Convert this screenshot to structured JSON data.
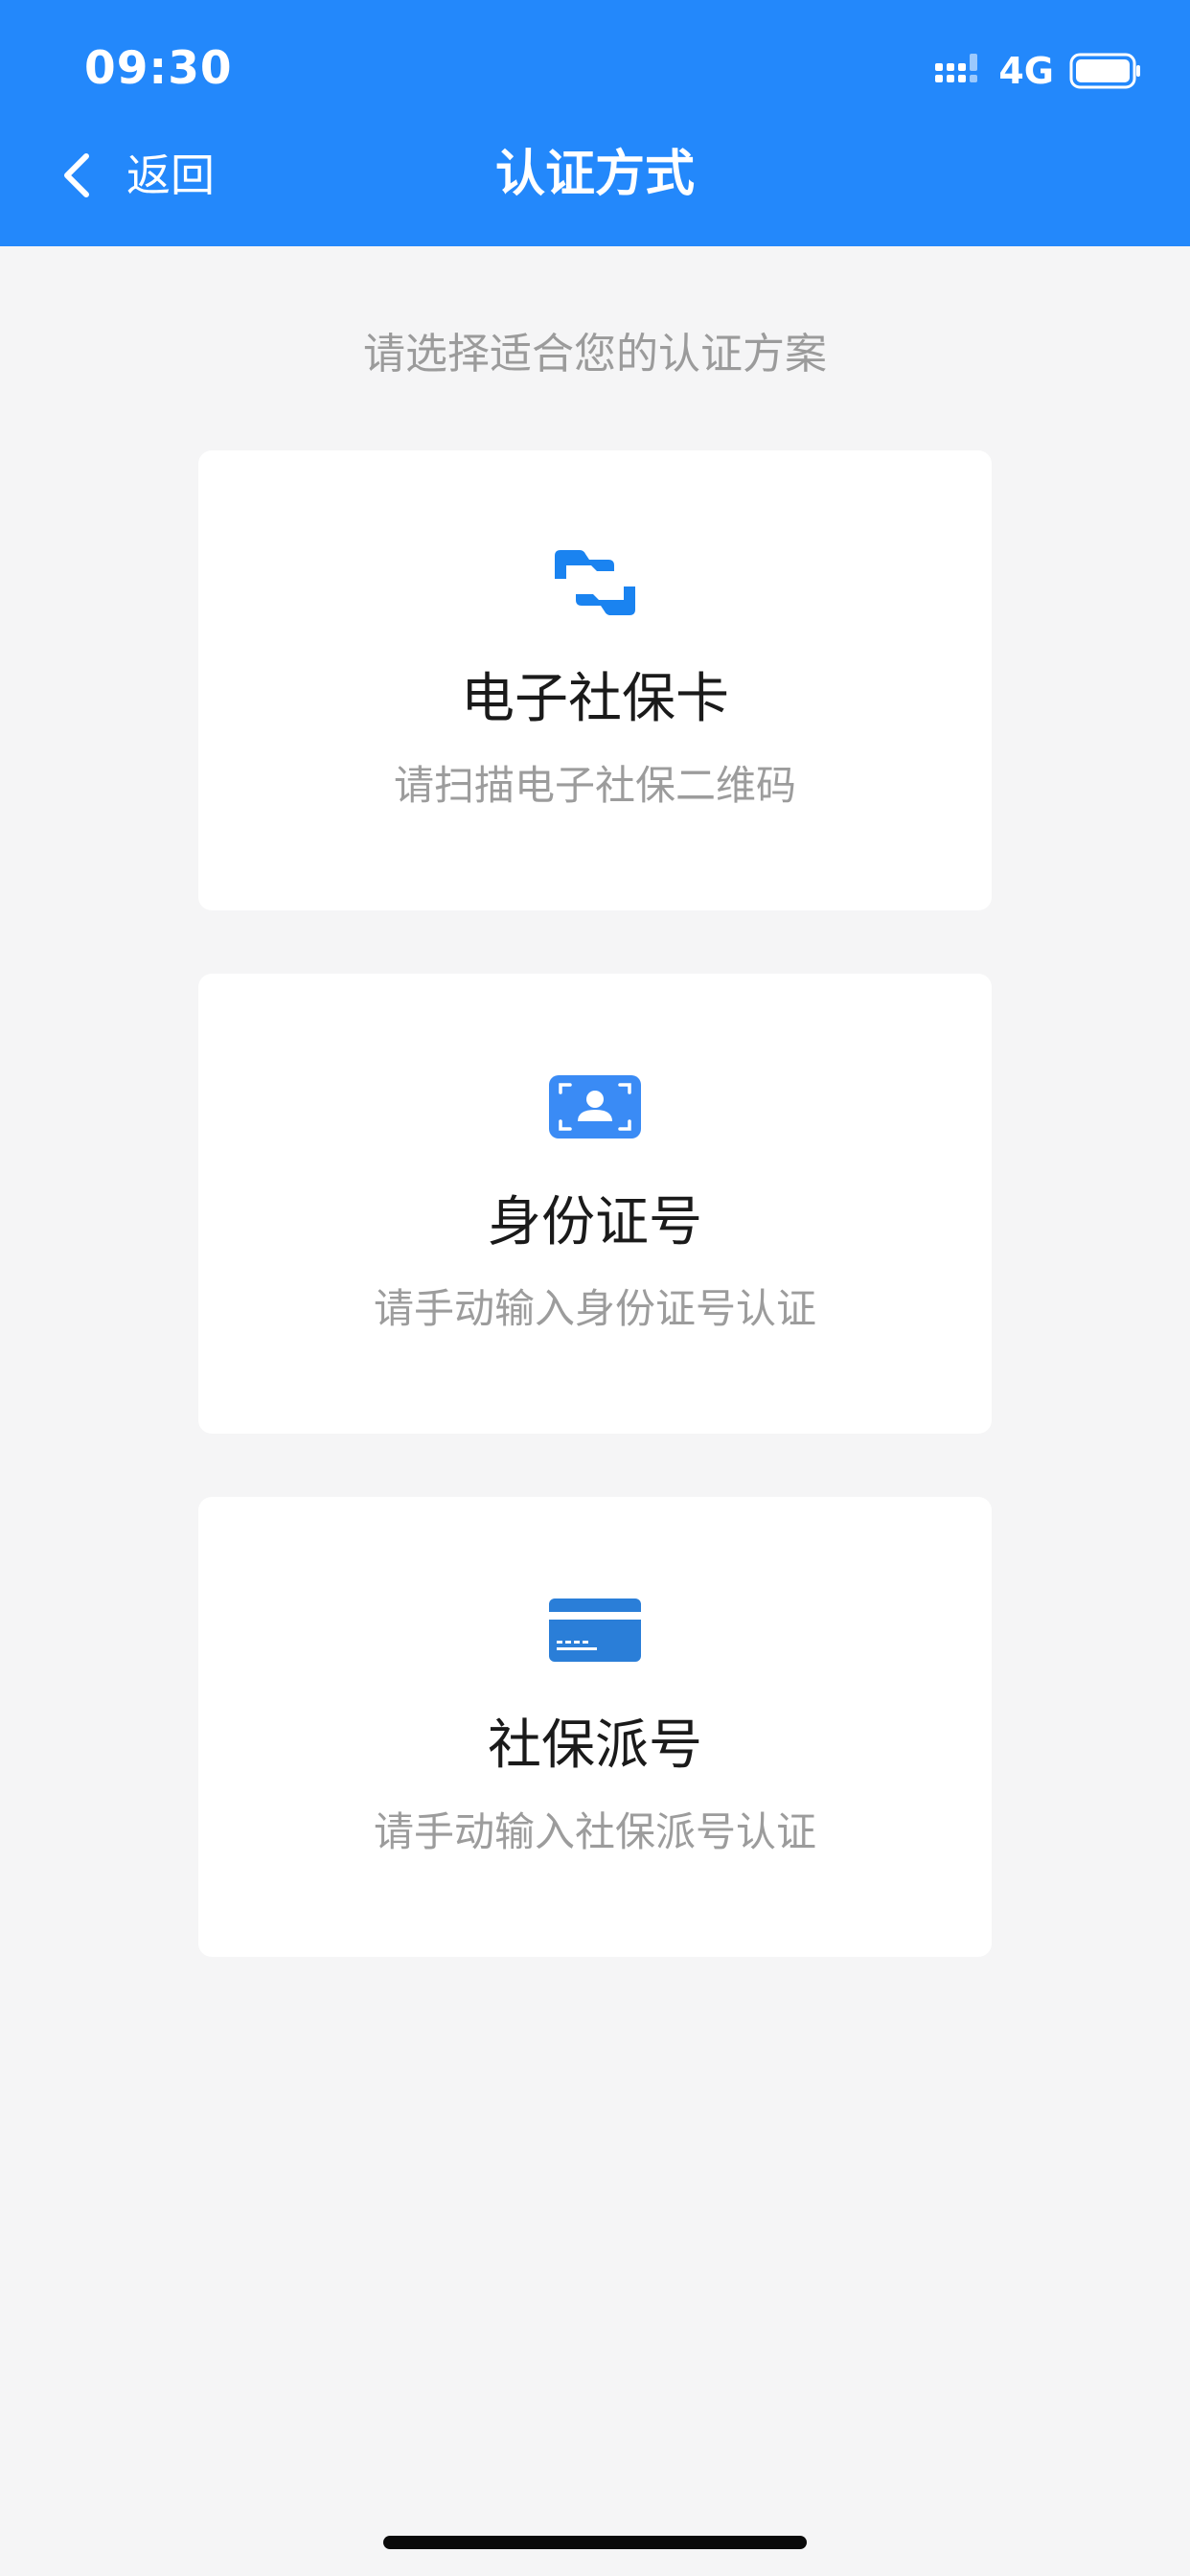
{
  "status_bar": {
    "time": "09:30",
    "network": "4G",
    "icons": [
      "signal-icon",
      "battery-icon"
    ]
  },
  "nav": {
    "back_label": "返回",
    "title": "认证方式",
    "back_icon": "chevron-left-icon"
  },
  "subtitle": "请选择适合您的认证方案",
  "options": [
    {
      "icon": "qr-scan-icon",
      "title": "电子社保卡",
      "desc": "请扫描电子社保二维码"
    },
    {
      "icon": "id-card-icon",
      "title": "身份证号",
      "desc": "请手动输入身份证号认证"
    },
    {
      "icon": "bank-card-icon",
      "title": "社保派号",
      "desc": "请手动输入社保派号认证"
    }
  ],
  "colors": {
    "header": "#2388fb",
    "background": "#f5f5f6",
    "icon_blue": "#1a83f0"
  }
}
